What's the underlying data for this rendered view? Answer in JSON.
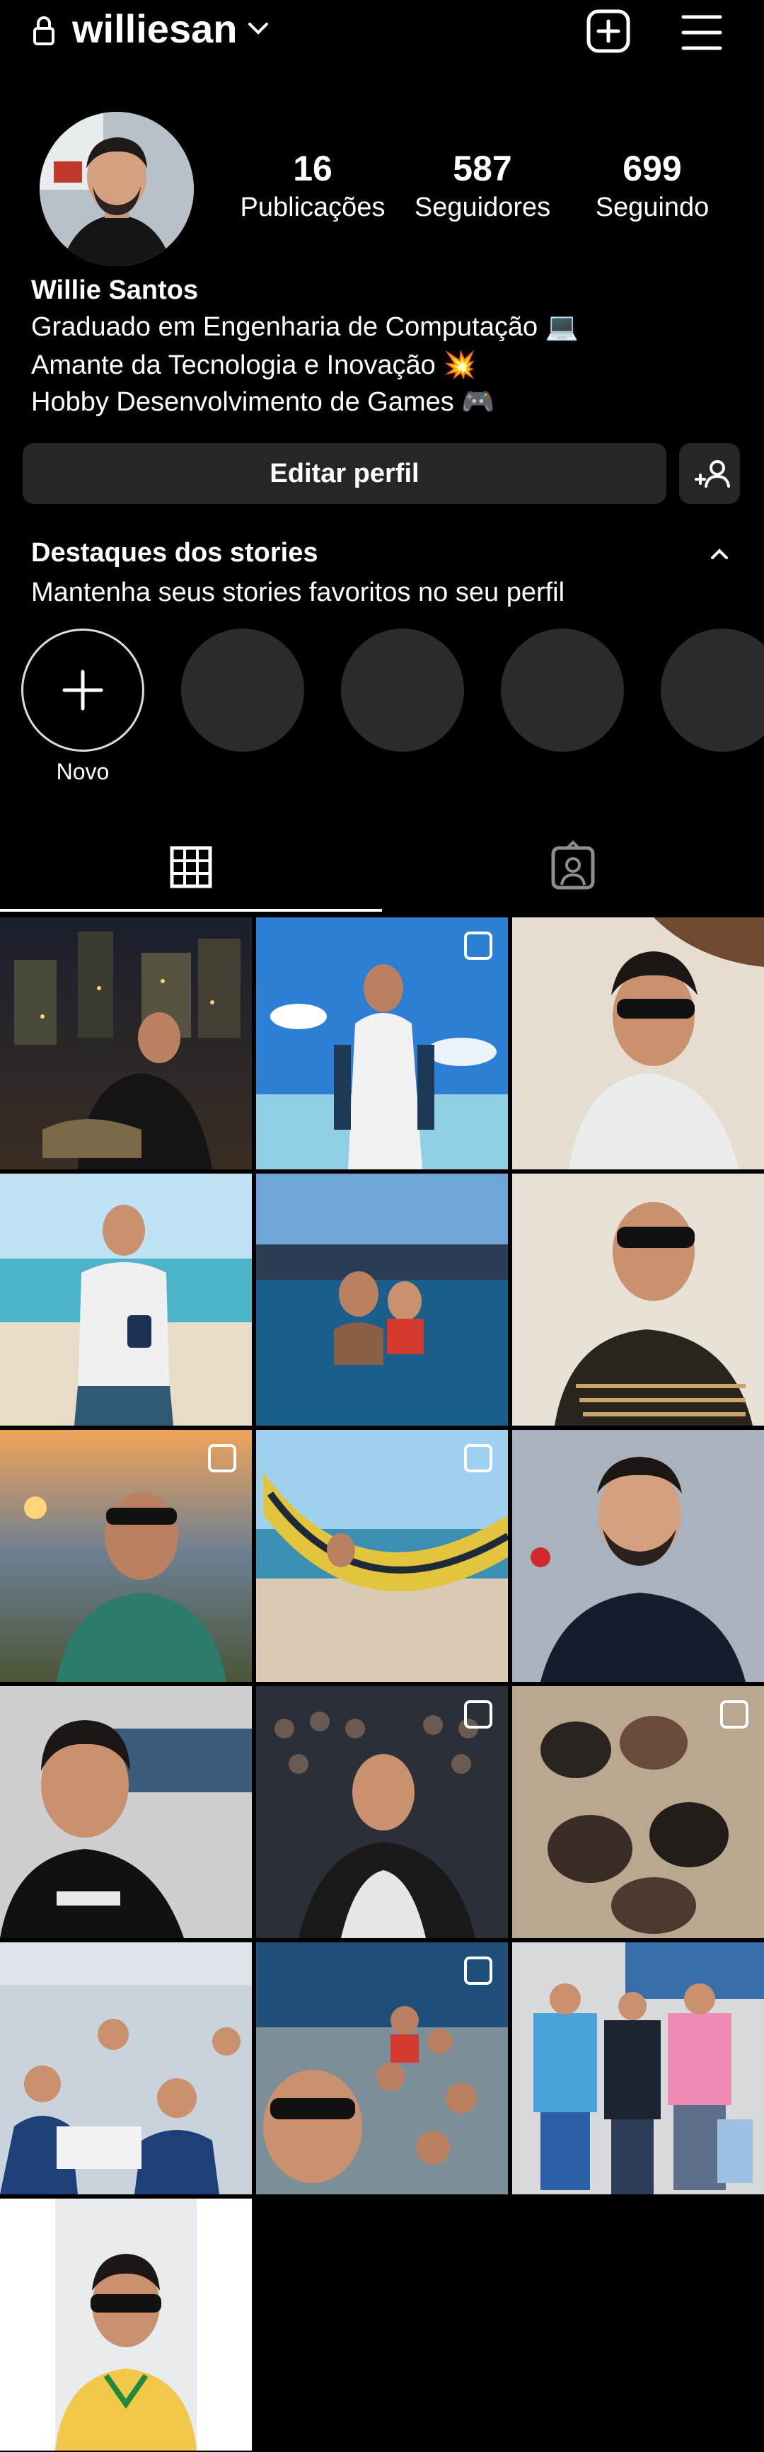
{
  "header": {
    "username": "williesan",
    "icons": [
      "lock-icon",
      "chevron-down-icon",
      "add-post-icon",
      "menu-icon"
    ]
  },
  "profile": {
    "stats": [
      {
        "value": "16",
        "label": "Publicações"
      },
      {
        "value": "587",
        "label": "Seguidores"
      },
      {
        "value": "699",
        "label": "Seguindo"
      }
    ],
    "name": "Willie Santos",
    "bio": [
      "Graduado em Engenharia de Computação 💻",
      "Amante da Tecnologia e Inovação 💥",
      "Hobby Desenvolvimento de Games 🎮"
    ],
    "edit_label": "Editar perfil"
  },
  "highlights": {
    "title": "Destaques dos stories",
    "subtitle": "Mantenha seus stories favoritos no seu perfil",
    "new_label": "Novo"
  },
  "tabs": [
    "grid-icon",
    "tagged-icon"
  ],
  "colors": {
    "background": "#000000",
    "button": "#262626",
    "highlight_placeholder": "#2b2b2b"
  }
}
